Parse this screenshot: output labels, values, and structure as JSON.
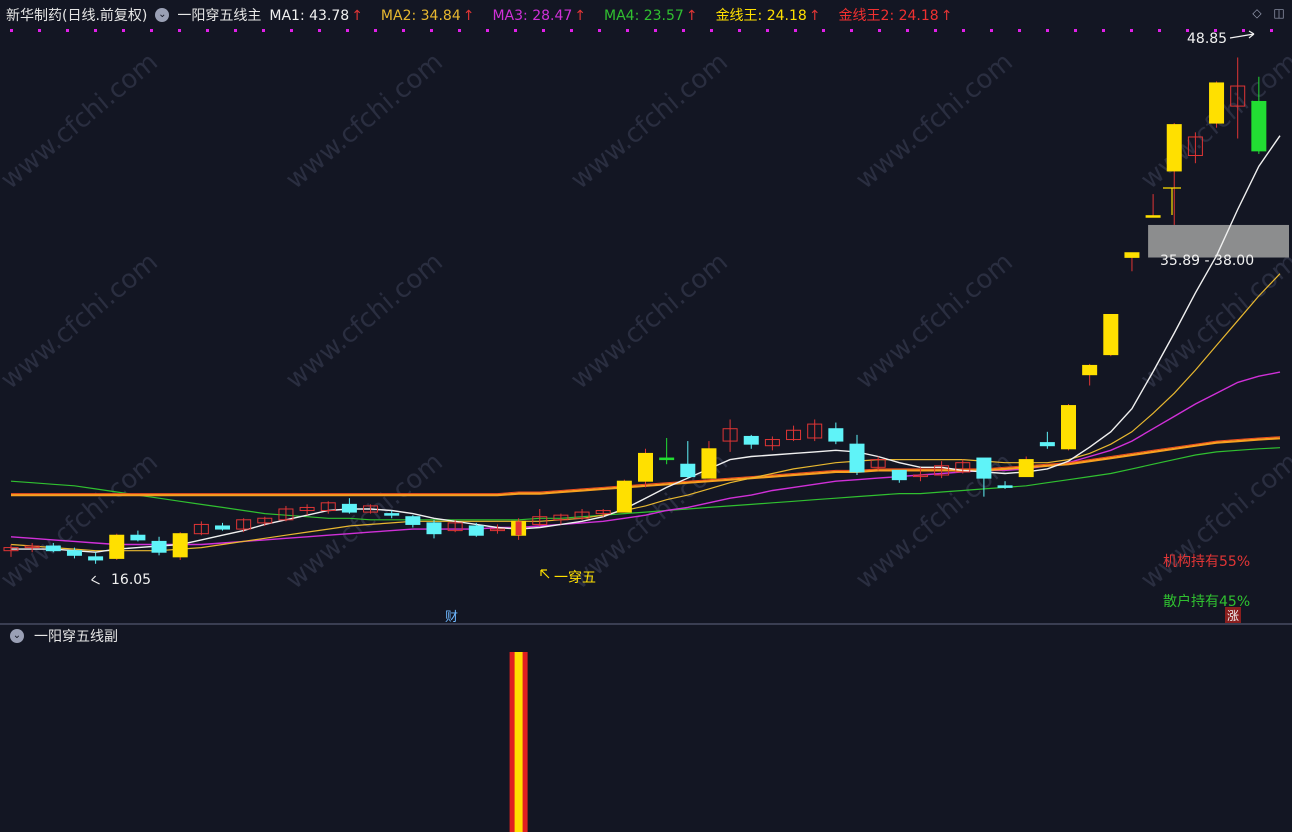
{
  "header": {
    "stock_name": "新华制药(日线.前复权)",
    "indicator_name": "一阳穿五线主",
    "ma_items": [
      {
        "label": "MA1: 43.78",
        "color": "#f0f0f0"
      },
      {
        "label": "MA2: 34.84",
        "color": "#e8b830"
      },
      {
        "label": "MA3: 28.47",
        "color": "#d030d8"
      },
      {
        "label": "MA4: 23.57",
        "color": "#30c030"
      },
      {
        "label": "金线王: 24.18",
        "color": "#ffe000"
      },
      {
        "label": "金线王2: 24.18",
        "color": "#f03030"
      }
    ],
    "arrow_glyph": "↑",
    "icons": [
      "diamond-icon",
      "panel-toggle-icon"
    ]
  },
  "sub_panel": {
    "title": "一阳穿五线副"
  },
  "annotations": {
    "high_label": "48.85",
    "low_label": "16.05",
    "range_label": "35.89 - 38.00",
    "signal_label": "一穿五",
    "institution_label": "机构持有55%",
    "retail_label": "散户持有45%",
    "fin_badge": "财",
    "rise_badge": "涨"
  },
  "colors": {
    "background": "#131623",
    "up_candle": "#e03535",
    "down_candle": "#5ff3f8",
    "signal_candle": "#ffe000",
    "ma1": "#f0f0f0",
    "ma2": "#e8b830",
    "ma3": "#d030d8",
    "ma4": "#30c030",
    "gold": "#f7a020",
    "gold2": "#f05020"
  },
  "chart_data": {
    "type": "candlestick",
    "title": "新华制药(日线.前复权)",
    "candles": [
      {
        "o": 16.9,
        "h": 17.3,
        "l": 16.5,
        "c": 17.1
      },
      {
        "o": 17.1,
        "h": 17.4,
        "l": 16.8,
        "c": 17.2
      },
      {
        "o": 17.2,
        "h": 17.4,
        "l": 16.8,
        "c": 16.9
      },
      {
        "o": 16.9,
        "h": 17.1,
        "l": 16.4,
        "c": 16.6
      },
      {
        "o": 16.5,
        "h": 16.8,
        "l": 16.05,
        "c": 16.3
      },
      {
        "o": 16.4,
        "h": 18.0,
        "l": 16.3,
        "c": 17.9,
        "signal": true
      },
      {
        "o": 17.9,
        "h": 18.2,
        "l": 17.5,
        "c": 17.6
      },
      {
        "o": 17.5,
        "h": 17.8,
        "l": 16.6,
        "c": 16.8
      },
      {
        "o": 16.5,
        "h": 18.1,
        "l": 16.3,
        "c": 18.0,
        "signal": true
      },
      {
        "o": 18.0,
        "h": 18.8,
        "l": 17.9,
        "c": 18.6
      },
      {
        "o": 18.5,
        "h": 18.7,
        "l": 18.2,
        "c": 18.3
      },
      {
        "o": 18.3,
        "h": 19.0,
        "l": 18.1,
        "c": 18.9
      },
      {
        "o": 18.7,
        "h": 19.1,
        "l": 18.5,
        "c": 19.0
      },
      {
        "o": 18.9,
        "h": 19.8,
        "l": 18.8,
        "c": 19.6
      },
      {
        "o": 19.5,
        "h": 19.9,
        "l": 19.2,
        "c": 19.7
      },
      {
        "o": 19.5,
        "h": 20.1,
        "l": 19.3,
        "c": 20.0
      },
      {
        "o": 19.9,
        "h": 20.3,
        "l": 19.3,
        "c": 19.4
      },
      {
        "o": 19.4,
        "h": 19.9,
        "l": 19.3,
        "c": 19.8
      },
      {
        "o": 19.3,
        "h": 19.5,
        "l": 19.0,
        "c": 19.2
      },
      {
        "o": 19.1,
        "h": 19.2,
        "l": 18.4,
        "c": 18.6
      },
      {
        "o": 18.7,
        "h": 18.9,
        "l": 17.7,
        "c": 18.0
      },
      {
        "o": 18.2,
        "h": 18.9,
        "l": 18.1,
        "c": 18.7
      },
      {
        "o": 18.5,
        "h": 18.7,
        "l": 17.8,
        "c": 17.9
      },
      {
        "o": 18.2,
        "h": 18.6,
        "l": 18.0,
        "c": 18.3
      },
      {
        "o": 17.9,
        "h": 19.0,
        "l": 17.6,
        "c": 18.8,
        "signal": true
      },
      {
        "o": 18.6,
        "h": 19.6,
        "l": 18.5,
        "c": 19.1
      },
      {
        "o": 18.9,
        "h": 19.3,
        "l": 18.6,
        "c": 19.2
      },
      {
        "o": 19.0,
        "h": 19.6,
        "l": 18.9,
        "c": 19.4
      },
      {
        "o": 19.3,
        "h": 19.6,
        "l": 19.1,
        "c": 19.5
      },
      {
        "o": 19.4,
        "h": 21.5,
        "l": 19.4,
        "c": 21.4,
        "signal": true
      },
      {
        "o": 21.4,
        "h": 23.5,
        "l": 21.0,
        "c": 23.2,
        "signal": true
      },
      {
        "o": 22.9,
        "h": 24.2,
        "l": 22.5,
        "c": 22.8,
        "greenfill": true
      },
      {
        "o": 22.5,
        "h": 24.0,
        "l": 21.6,
        "c": 21.7
      },
      {
        "o": 21.6,
        "h": 24.0,
        "l": 21.6,
        "c": 23.5,
        "signal": true
      },
      {
        "o": 24.0,
        "h": 25.4,
        "l": 23.3,
        "c": 24.8
      },
      {
        "o": 24.3,
        "h": 24.4,
        "l": 23.5,
        "c": 23.8
      },
      {
        "o": 23.7,
        "h": 24.3,
        "l": 23.4,
        "c": 24.1
      },
      {
        "o": 24.1,
        "h": 25.0,
        "l": 24.0,
        "c": 24.7
      },
      {
        "o": 24.2,
        "h": 25.4,
        "l": 24.0,
        "c": 25.1
      },
      {
        "o": 24.8,
        "h": 25.2,
        "l": 23.8,
        "c": 24.0
      },
      {
        "o": 23.8,
        "h": 24.4,
        "l": 21.8,
        "c": 22.0
      },
      {
        "o": 22.3,
        "h": 23.0,
        "l": 22.1,
        "c": 22.8
      },
      {
        "o": 22.1,
        "h": 22.1,
        "l": 21.3,
        "c": 21.5
      },
      {
        "o": 21.7,
        "h": 22.3,
        "l": 21.4,
        "c": 21.8
      },
      {
        "o": 21.8,
        "h": 22.7,
        "l": 21.6,
        "c": 22.4
      },
      {
        "o": 22.0,
        "h": 22.8,
        "l": 21.9,
        "c": 22.6
      },
      {
        "o": 22.9,
        "h": 22.9,
        "l": 20.4,
        "c": 21.6
      },
      {
        "o": 21.1,
        "h": 21.4,
        "l": 20.9,
        "c": 21.0
      },
      {
        "o": 21.7,
        "h": 23.0,
        "l": 21.7,
        "c": 22.8,
        "signal": true
      },
      {
        "o": 23.9,
        "h": 24.6,
        "l": 23.5,
        "c": 23.7
      },
      {
        "o": 23.5,
        "h": 26.4,
        "l": 23.4,
        "c": 26.3,
        "signal": true
      },
      {
        "o": 28.3,
        "h": 29.0,
        "l": 27.6,
        "c": 28.9,
        "signal": true
      },
      {
        "o": 29.6,
        "h": 32.2,
        "l": 29.5,
        "c": 32.2,
        "signal": true
      },
      {
        "o": 35.9,
        "h": 36.2,
        "l": 35.0,
        "c": 36.2,
        "signal": true
      },
      {
        "o": 38.5,
        "h": 40.0,
        "l": 38.5,
        "c": 38.6,
        "signal": true
      },
      {
        "o": 41.5,
        "h": 44.6,
        "l": 38.0,
        "c": 44.5,
        "signal": true
      },
      {
        "o": 42.5,
        "h": 44.0,
        "l": 42.0,
        "c": 43.7
      },
      {
        "o": 44.6,
        "h": 47.3,
        "l": 44.3,
        "c": 47.2,
        "signal": true
      },
      {
        "o": 45.7,
        "h": 48.85,
        "l": 43.6,
        "c": 47.0
      },
      {
        "o": 46.0,
        "h": 47.6,
        "l": 42.6,
        "c": 42.8,
        "greenfill": true
      }
    ],
    "ma1": [
      17.0,
      17.0,
      17.0,
      16.9,
      16.8,
      17.0,
      17.1,
      17.2,
      17.3,
      17.6,
      17.9,
      18.2,
      18.6,
      18.9,
      19.2,
      19.5,
      19.6,
      19.6,
      19.5,
      19.3,
      19.0,
      18.8,
      18.6,
      18.4,
      18.3,
      18.4,
      18.6,
      18.8,
      19.1,
      19.6,
      20.3,
      21.0,
      21.6,
      22.2,
      22.8,
      23.0,
      23.1,
      23.2,
      23.3,
      23.4,
      23.3,
      23.0,
      22.6,
      22.3,
      22.3,
      22.1,
      22.0,
      21.9,
      22.0,
      22.2,
      22.7,
      23.6,
      24.6,
      26.1,
      28.5,
      31.0,
      33.6,
      36.0,
      39.0,
      41.8,
      43.78
    ],
    "ma2": [
      17.3,
      17.2,
      17.1,
      17.0,
      16.9,
      16.9,
      16.9,
      16.9,
      17.0,
      17.1,
      17.3,
      17.5,
      17.7,
      17.9,
      18.1,
      18.3,
      18.5,
      18.6,
      18.7,
      18.8,
      18.8,
      18.8,
      18.8,
      18.8,
      18.8,
      18.8,
      18.9,
      19.0,
      19.2,
      19.5,
      19.8,
      20.2,
      20.5,
      20.9,
      21.3,
      21.6,
      21.9,
      22.2,
      22.4,
      22.6,
      22.7,
      22.8,
      22.8,
      22.8,
      22.8,
      22.8,
      22.7,
      22.6,
      22.6,
      22.6,
      22.8,
      23.2,
      23.8,
      24.6,
      25.8,
      27.1,
      28.6,
      30.2,
      31.8,
      33.4,
      34.84
    ],
    "ma3": [
      17.8,
      17.7,
      17.6,
      17.5,
      17.4,
      17.3,
      17.3,
      17.3,
      17.3,
      17.3,
      17.4,
      17.5,
      17.6,
      17.7,
      17.8,
      17.9,
      18.0,
      18.1,
      18.2,
      18.3,
      18.3,
      18.3,
      18.3,
      18.4,
      18.4,
      18.5,
      18.6,
      18.7,
      18.8,
      19.0,
      19.2,
      19.5,
      19.7,
      20.0,
      20.3,
      20.5,
      20.8,
      21.0,
      21.2,
      21.4,
      21.5,
      21.6,
      21.7,
      21.8,
      21.9,
      22.0,
      22.1,
      22.1,
      22.2,
      22.4,
      22.6,
      23.0,
      23.4,
      24.0,
      24.8,
      25.6,
      26.4,
      27.1,
      27.8,
      28.2,
      28.47
    ],
    "ma4": [
      21.4,
      21.3,
      21.2,
      21.1,
      20.9,
      20.7,
      20.5,
      20.3,
      20.1,
      19.9,
      19.7,
      19.5,
      19.3,
      19.2,
      19.1,
      19.0,
      19.0,
      18.9,
      18.9,
      18.9,
      18.9,
      18.9,
      18.9,
      18.9,
      18.9,
      19.0,
      19.0,
      19.1,
      19.2,
      19.3,
      19.4,
      19.5,
      19.6,
      19.7,
      19.8,
      19.9,
      20.0,
      20.1,
      20.2,
      20.3,
      20.4,
      20.5,
      20.6,
      20.6,
      20.7,
      20.8,
      20.9,
      21.0,
      21.1,
      21.3,
      21.5,
      21.7,
      21.9,
      22.2,
      22.5,
      22.8,
      23.1,
      23.3,
      23.4,
      23.5,
      23.57
    ],
    "gold": [
      20.5,
      20.5,
      20.5,
      20.5,
      20.5,
      20.5,
      20.5,
      20.5,
      20.5,
      20.5,
      20.5,
      20.5,
      20.5,
      20.5,
      20.5,
      20.5,
      20.5,
      20.5,
      20.5,
      20.5,
      20.5,
      20.5,
      20.5,
      20.5,
      20.6,
      20.6,
      20.7,
      20.8,
      20.9,
      21.0,
      21.1,
      21.2,
      21.3,
      21.4,
      21.5,
      21.6,
      21.7,
      21.8,
      21.9,
      22.0,
      22.0,
      22.1,
      22.1,
      22.1,
      22.1,
      22.1,
      22.1,
      22.2,
      22.3,
      22.4,
      22.5,
      22.7,
      22.9,
      23.1,
      23.3,
      23.5,
      23.7,
      23.9,
      24.0,
      24.1,
      24.18
    ],
    "sub_signals": [
      {
        "index": 24,
        "value": 1
      }
    ],
    "ylim": [
      15.0,
      50.5
    ],
    "gray_band": [
      35.89,
      38.0
    ]
  }
}
